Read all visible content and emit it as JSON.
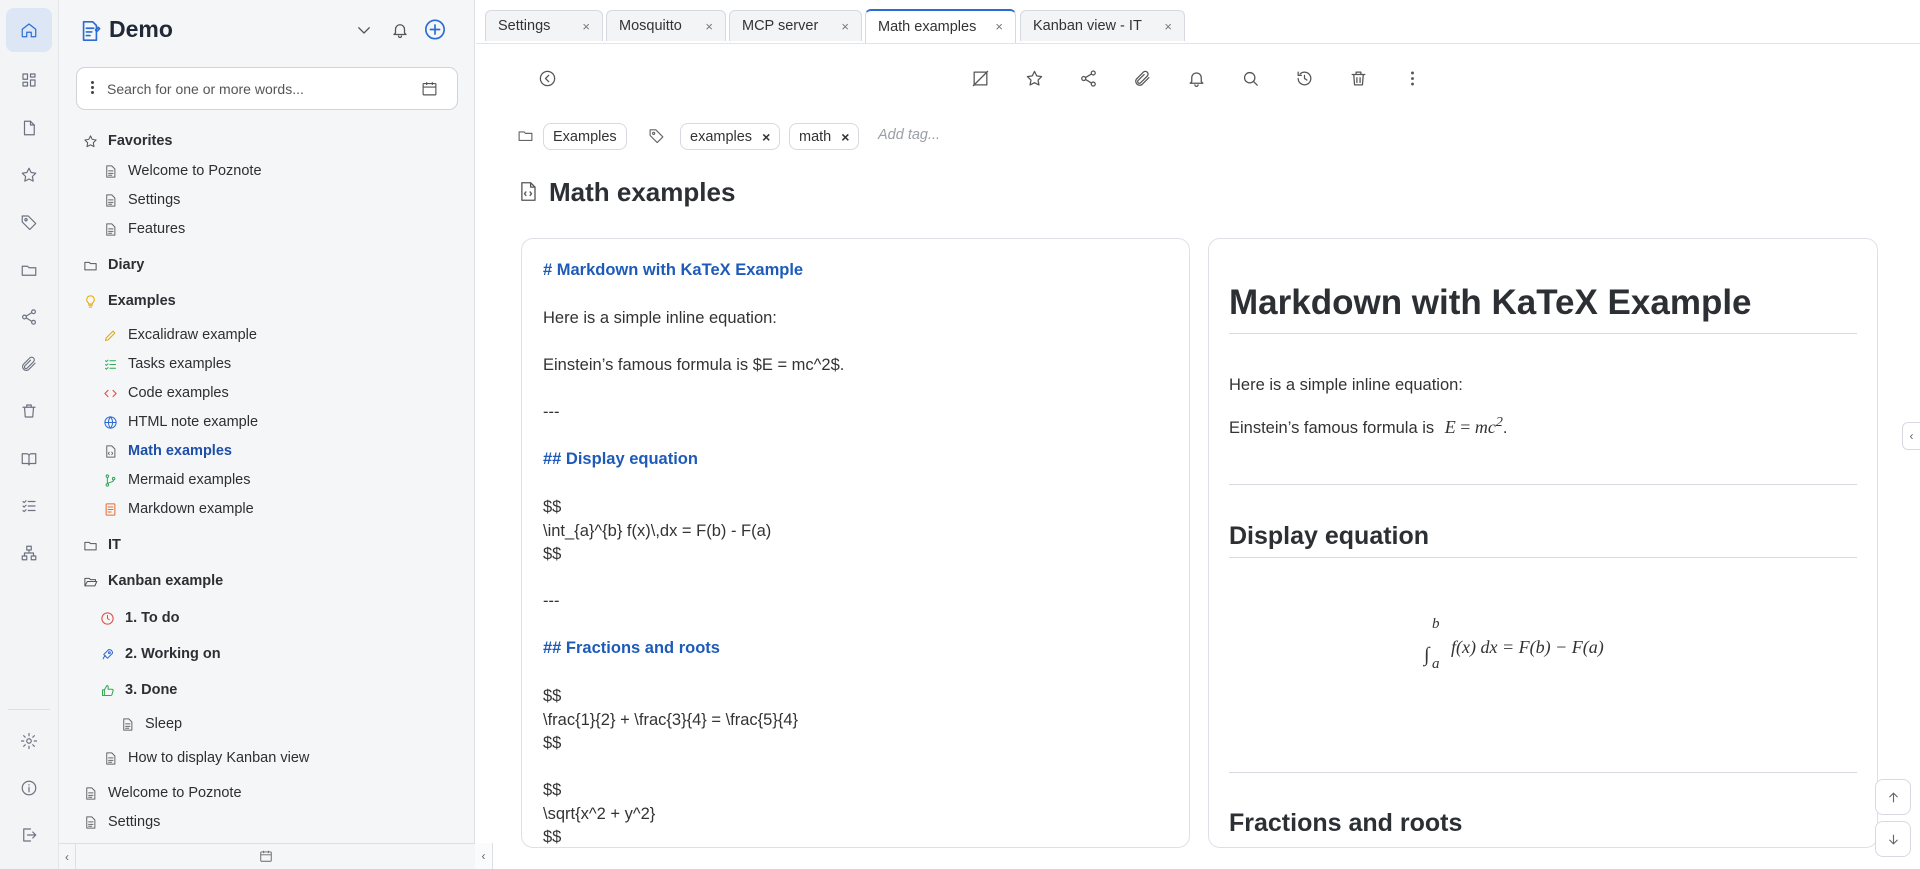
{
  "workspace": {
    "title": "Demo"
  },
  "search": {
    "placeholder": "Search for one or more words..."
  },
  "rail": {
    "icons": [
      "home-icon",
      "dashboard-icon",
      "notes-icon",
      "favorites-icon",
      "tags-icon",
      "folders-icon",
      "share-icon",
      "attachments-icon",
      "trash-icon",
      "book-icon",
      "tasks-icon",
      "hierarchy-icon",
      "settings-icon",
      "info-icon",
      "logout-icon"
    ]
  },
  "tree": {
    "favorites": {
      "label": "Favorites",
      "items": [
        "Welcome to Poznote",
        "Settings",
        "Features"
      ]
    },
    "diary": {
      "label": "Diary"
    },
    "examples": {
      "label": "Examples",
      "items": [
        "Excalidraw example",
        "Tasks examples",
        "Code examples",
        "HTML note example",
        "Math examples",
        "Mermaid examples",
        "Markdown example"
      ]
    },
    "it": {
      "label": "IT"
    },
    "kanban": {
      "label": "Kanban example",
      "columns": [
        "1. To do",
        "2. Working on",
        "3. Done"
      ],
      "done_items": [
        "Sleep"
      ],
      "extra": "How to display Kanban view"
    },
    "root_items": [
      "Welcome to Poznote",
      "Settings"
    ]
  },
  "tabs": [
    {
      "label": "Settings",
      "close": "×"
    },
    {
      "label": "Mosquitto",
      "close": "×"
    },
    {
      "label": "MCP server",
      "close": "×"
    },
    {
      "label": "Math examples",
      "close": "×"
    },
    {
      "label": "Kanban view - IT",
      "close": "×"
    }
  ],
  "note": {
    "folder": "Examples",
    "tags": [
      "examples",
      "math"
    ],
    "tag_remove": "×",
    "add_tag_placeholder": "Add tag...",
    "title": "Math examples"
  },
  "editor": {
    "lines": [
      "# Markdown with KaTeX Example",
      "Here is a simple inline equation:",
      "Einstein’s famous formula is $E = mc^2$.",
      "---",
      "## Display equation",
      "$$",
      "\\int_{a}^{b} f(x)\\,dx = F(b) - F(a)",
      "$$",
      "---",
      "## Fractions and roots",
      "$$",
      "\\frac{1}{2} + \\frac{3}{4} = \\frac{5}{4}",
      "$$",
      "$$",
      "\\sqrt{x^2 + y^2}",
      "$$"
    ]
  },
  "preview": {
    "h1": "Markdown with KaTeX Example",
    "p1": "Here is a simple inline equation:",
    "p2_prefix": "Einstein’s famous formula is",
    "inline_math": {
      "lhs": "E",
      "eq": "=",
      "base": "mc",
      "exp": "2"
    },
    "p2_suffix": ".",
    "h2_display": "Display equation",
    "display_math": {
      "integral": "∫",
      "upper": "b",
      "lower": "a",
      "body": "f(x) dx = F(b) − F(a)"
    },
    "h2_fractions": "Fractions and roots"
  },
  "colors": {
    "accent": "#2a6bd4",
    "heading_md": "#1e5bb8",
    "active_tree": "#1e4fa8"
  }
}
